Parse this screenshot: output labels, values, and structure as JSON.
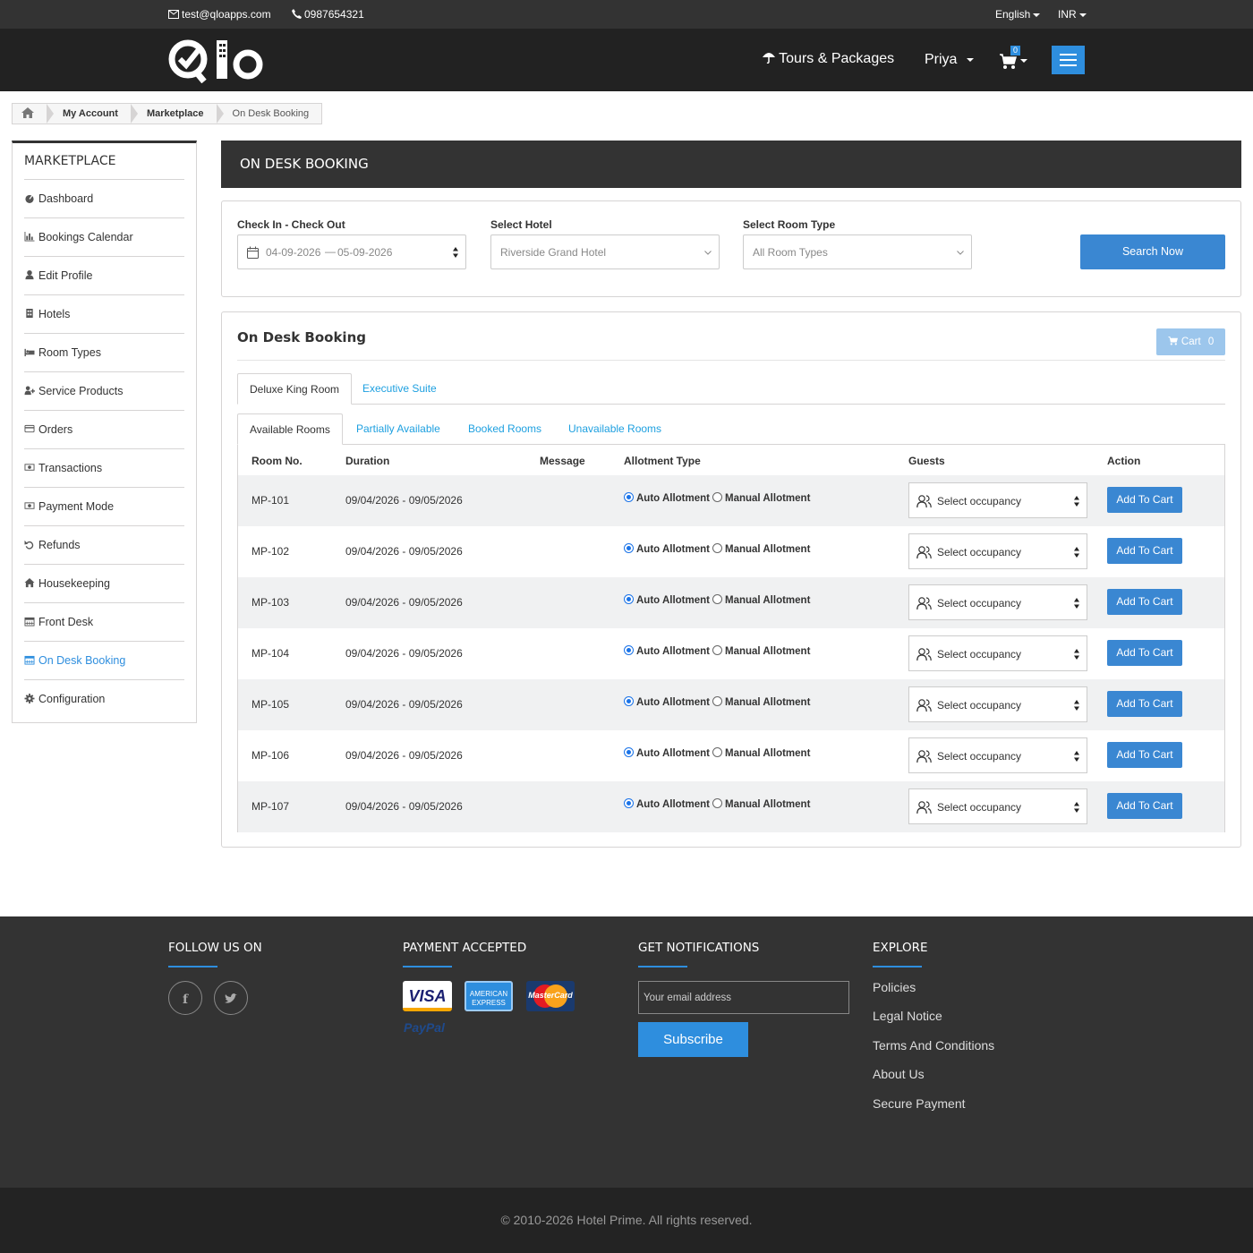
{
  "topbar": {
    "email": "test@qloapps.com",
    "phone": "0987654321",
    "language": "English",
    "currency": "INR"
  },
  "header": {
    "tours_label": "Tours & Packages",
    "user_name": "Priya",
    "cart_count": "0"
  },
  "breadcrumb": {
    "items": [
      "My Account",
      "Marketplace",
      "On Desk Booking"
    ]
  },
  "sidebar": {
    "title": "MARKETPLACE",
    "items": [
      {
        "label": "Dashboard",
        "icon": "dashboard-icon"
      },
      {
        "label": "Bookings Calendar",
        "icon": "bar-chart-icon"
      },
      {
        "label": "Edit Profile",
        "icon": "user-icon"
      },
      {
        "label": "Hotels",
        "icon": "building-icon"
      },
      {
        "label": "Room Types",
        "icon": "bed-icon"
      },
      {
        "label": "Service Products",
        "icon": "user-plus-icon"
      },
      {
        "label": "Orders",
        "icon": "credit-card-icon"
      },
      {
        "label": "Transactions",
        "icon": "money-icon"
      },
      {
        "label": "Payment Mode",
        "icon": "money-icon"
      },
      {
        "label": "Refunds",
        "icon": "undo-icon"
      },
      {
        "label": "Housekeeping",
        "icon": "home-icon"
      },
      {
        "label": "Front Desk",
        "icon": "calendar-icon"
      },
      {
        "label": "On Desk Booking",
        "icon": "calendar-icon",
        "active": true
      },
      {
        "label": "Configuration",
        "icon": "gear-icon"
      }
    ]
  },
  "page": {
    "title": "ON DESK BOOKING"
  },
  "filters": {
    "dates_label": "Check In - Check Out",
    "check_in": "04-09-2026",
    "dash": "—",
    "check_out": "05-09-2026",
    "hotel_label": "Select Hotel",
    "hotel_value": "Riverside Grand Hotel",
    "room_type_label": "Select Room Type",
    "room_type_value": "All Room Types",
    "search_button": "Search Now"
  },
  "booking": {
    "title": "On Desk Booking",
    "cart_label": "Cart",
    "cart_count": "0",
    "room_tabs": [
      "Deluxe King Room",
      "Executive Suite"
    ],
    "status_tabs": [
      "Available Rooms",
      "Partially Available",
      "Booked Rooms",
      "Unavailable Rooms"
    ],
    "columns": [
      "Room No.",
      "Duration",
      "Message",
      "Allotment Type",
      "Guests",
      "Action"
    ],
    "auto_label": "Auto Allotment",
    "manual_label": "Manual Allotment",
    "occupancy_placeholder": "Select occupancy",
    "add_button": "Add To Cart",
    "rows": [
      {
        "room": "MP-101",
        "duration": "09/04/2026 - 09/05/2026"
      },
      {
        "room": "MP-102",
        "duration": "09/04/2026 - 09/05/2026"
      },
      {
        "room": "MP-103",
        "duration": "09/04/2026 - 09/05/2026"
      },
      {
        "room": "MP-104",
        "duration": "09/04/2026 - 09/05/2026"
      },
      {
        "room": "MP-105",
        "duration": "09/04/2026 - 09/05/2026"
      },
      {
        "room": "MP-106",
        "duration": "09/04/2026 - 09/05/2026"
      },
      {
        "room": "MP-107",
        "duration": "09/04/2026 - 09/05/2026"
      }
    ]
  },
  "footer": {
    "follow_title": "FOLLOW US ON",
    "payment_title": "PAYMENT ACCEPTED",
    "payment_methods": [
      "VISA",
      "AMERICAN EXPRESS",
      "MasterCard",
      "PayPal"
    ],
    "notify_title": "GET NOTIFICATIONS",
    "email_placeholder": "Your email address",
    "subscribe_button": "Subscribe",
    "explore_title": "EXPLORE",
    "explore_links": [
      "Policies",
      "Legal Notice",
      "Terms And Conditions",
      "About Us",
      "Secure Payment"
    ],
    "copyright": "© 2010-2026  Hotel Prime.  All rights reserved."
  },
  "colors": {
    "accent": "#2e8ede",
    "button": "#3a87d2",
    "dark": "#333333",
    "tab_link": "#1ea0e0"
  }
}
